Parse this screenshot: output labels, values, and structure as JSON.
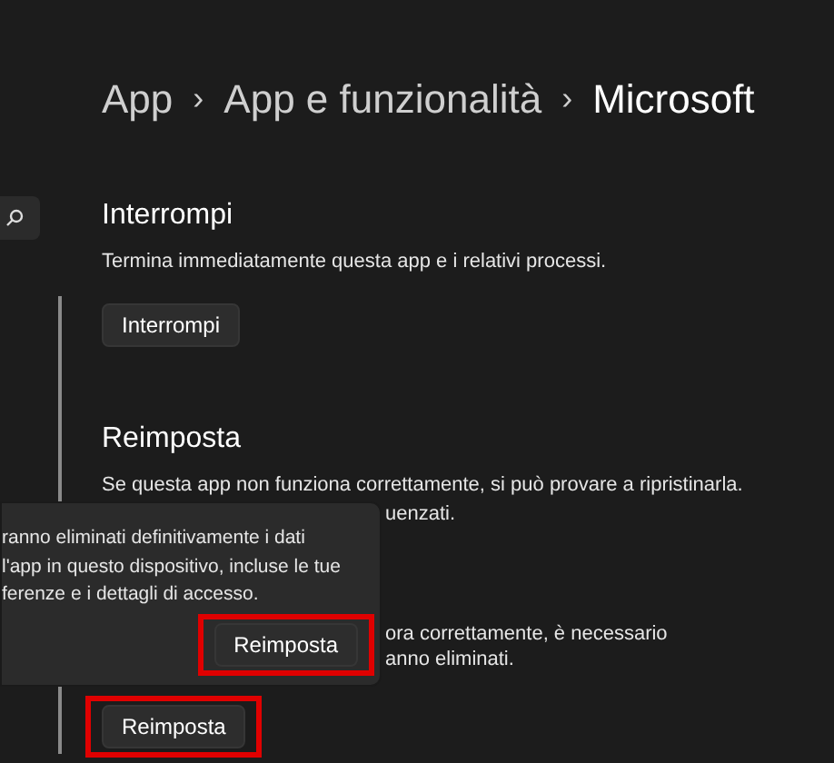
{
  "breadcrumb": [
    {
      "label": "App",
      "current": false
    },
    {
      "label": "App e funzionalità",
      "current": false
    },
    {
      "label": "Microsoft",
      "current": true
    }
  ],
  "breadcrumb_separator": "›",
  "sections": [
    {
      "title": "Interrompi",
      "description": [
        "Termina immediatamente questa app e i relativi processi."
      ],
      "button": {
        "label": "Interrompi",
        "highlighted": false
      }
    },
    {
      "title": "Reimposta",
      "description": [
        "Se questa app non funziona correttamente, si può provare a ripristinarla."
      ],
      "partly_covered_paragraphs": [
        [
          "uenzati."
        ],
        [
          "ora correttamente, è necessario",
          "anno eliminati."
        ]
      ],
      "button": {
        "label": "Reimposta",
        "highlighted": true
      }
    }
  ],
  "flyout": {
    "lines": [
      "ranno eliminati definitivamente i dati",
      "l'app in questo dispositivo, incluse le tue",
      "ferenze e i dettagli di accesso."
    ],
    "button": {
      "label": "Reimposta",
      "highlighted": true
    }
  }
}
